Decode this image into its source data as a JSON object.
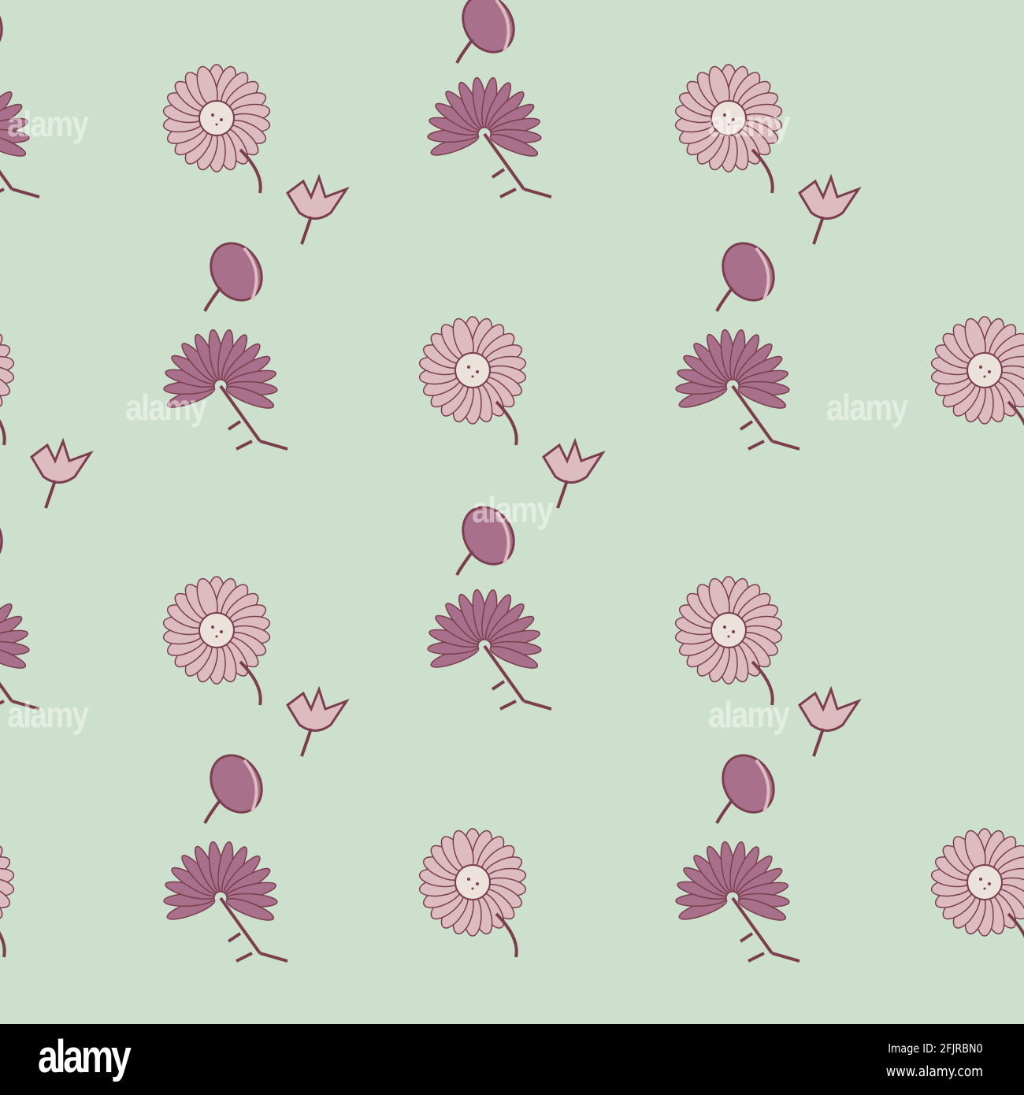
{
  "colors": {
    "background": "#cde0cd",
    "light_petal": "#dcbcc0",
    "dark_petal": "#a8708a",
    "outline": "#7a3e4e",
    "center": "#ece2dc"
  },
  "watermark": {
    "text": "alamy"
  },
  "footer": {
    "logo": "alamy",
    "image_id": "Image ID: 2FJRBN0",
    "website": "www.alamy.com"
  }
}
